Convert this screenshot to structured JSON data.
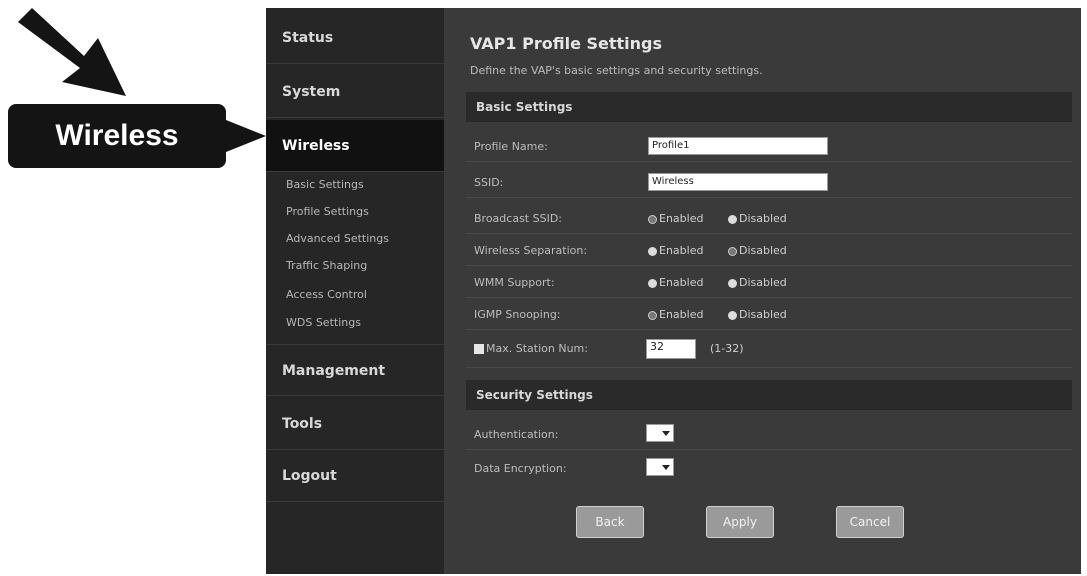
{
  "callout": {
    "label": "Wireless"
  },
  "sidebar": {
    "status": "Status",
    "system": "System",
    "wireless": "Wireless",
    "sub_items": [
      "Basic Settings",
      "Profile Settings",
      "Advanced Settings",
      "Traffic Shaping",
      "Access Control",
      "WDS Settings"
    ],
    "management": "Management",
    "tools": "Tools",
    "logout": "Logout"
  },
  "main": {
    "title": "VAP1 Profile Settings",
    "description": "Define the VAP's basic settings and security settings."
  },
  "basic": {
    "heading": "Basic Settings",
    "profile_name_label": "Profile Name:",
    "profile_name_value": "Profile1",
    "ssid_label": "SSID:",
    "ssid_value": "Wireless",
    "broadcast_label": "Broadcast SSID:",
    "separation_label": "Wireless Separation:",
    "wmm_label": "WMM Support:",
    "igmp_label": "IGMP Snooping:",
    "enabled": "Enabled",
    "disabled": "Disabled",
    "max_station_label": "Max. Station Num:",
    "max_station_value": "32",
    "max_station_range": "(1-32)"
  },
  "security": {
    "heading": "Security Settings",
    "authentication_label": "Authentication:",
    "encryption_label": "Data Encryption:"
  },
  "buttons": {
    "back": "Back",
    "apply": "Apply",
    "cancel": "Cancel"
  }
}
